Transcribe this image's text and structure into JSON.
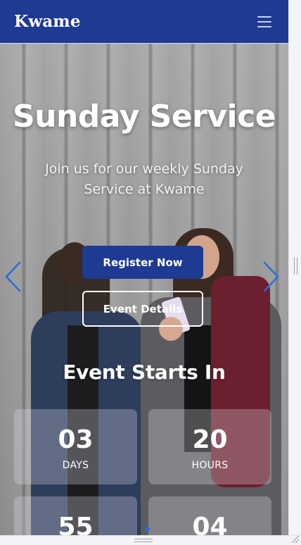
{
  "navbar": {
    "brand": "Kwame",
    "menu_icon": "hamburger-menu-icon"
  },
  "hero": {
    "title": "Sunday Service",
    "subtitle": "Join us for our weekly Sunday Service at Kwame",
    "register_label": "Register Now",
    "details_label": "Event Details",
    "prev_icon": "chevron-left-icon",
    "next_icon": "chevron-right-icon"
  },
  "countdown": {
    "title": "Event Starts In",
    "items": [
      {
        "value": "03",
        "label": "DAYS"
      },
      {
        "value": "20",
        "label": "HOURS"
      },
      {
        "value": "55",
        "label": ""
      },
      {
        "value": "04",
        "label": ""
      }
    ]
  },
  "colors": {
    "brand": "#1f3a93",
    "arrow": "#2a6fd6",
    "dot_active": "#2a6fd6"
  }
}
